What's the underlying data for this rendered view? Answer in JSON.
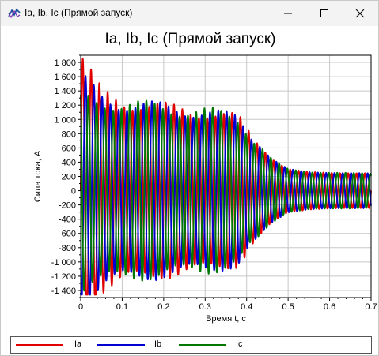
{
  "window": {
    "title": "Ia, Ib, Ic (Прямой запуск)",
    "icon": "app-waveform-icon",
    "controls": [
      "minimize-icon",
      "maximize-icon",
      "close-icon"
    ]
  },
  "chart_data": {
    "type": "line",
    "title": "Ia, Ib, Ic (Прямой запуск)",
    "xlabel": "Время t, c",
    "ylabel": "Сила тока, А",
    "xlim": [
      0,
      0.7
    ],
    "ylim": [
      -1500,
      1900
    ],
    "xticks": [
      "0",
      "0.1",
      "0.2",
      "0.3",
      "0.4",
      "0.5",
      "0.6",
      "0.7"
    ],
    "yticks": [
      "-1 400",
      "-1 200",
      "-1 000",
      "-800",
      "-600",
      "-400",
      "-200",
      "0",
      "200",
      "400",
      "600",
      "800",
      "1 000",
      "1 200",
      "1 400",
      "1 600",
      "1 800"
    ],
    "ytick_values": [
      -1400,
      -1200,
      -1000,
      -800,
      -600,
      -400,
      -200,
      0,
      200,
      400,
      600,
      800,
      1000,
      1200,
      1400,
      1600,
      1800
    ],
    "grid": true,
    "legend_position": "bottom",
    "frequency_hz": 50,
    "series": [
      {
        "name": "Ia",
        "color": "#e00000",
        "phase_deg": 0,
        "envelope": {
          "t": [
            0,
            0.01,
            0.05,
            0.1,
            0.2,
            0.3,
            0.38,
            0.42,
            0.46,
            0.5,
            0.55,
            0.7
          ],
          "amp": [
            1900,
            1750,
            1350,
            1250,
            1150,
            1100,
            1000,
            700,
            450,
            300,
            260,
            240
          ]
        }
      },
      {
        "name": "Ib",
        "color": "#0000d0",
        "phase_deg": -120,
        "envelope": {
          "t": [
            0,
            0.01,
            0.05,
            0.1,
            0.2,
            0.3,
            0.38,
            0.42,
            0.46,
            0.5,
            0.55,
            0.7
          ],
          "amp": [
            1550,
            1500,
            1300,
            1220,
            1150,
            1100,
            1000,
            700,
            450,
            300,
            260,
            240
          ]
        }
      },
      {
        "name": "Ic",
        "color": "#007800",
        "phase_deg": 120,
        "envelope": {
          "t": [
            0,
            0.01,
            0.05,
            0.1,
            0.2,
            0.3,
            0.38,
            0.42,
            0.46,
            0.5,
            0.55,
            0.7
          ],
          "amp": [
            1450,
            1300,
            1250,
            1200,
            1150,
            1100,
            1000,
            700,
            450,
            300,
            260,
            240
          ]
        }
      }
    ]
  }
}
